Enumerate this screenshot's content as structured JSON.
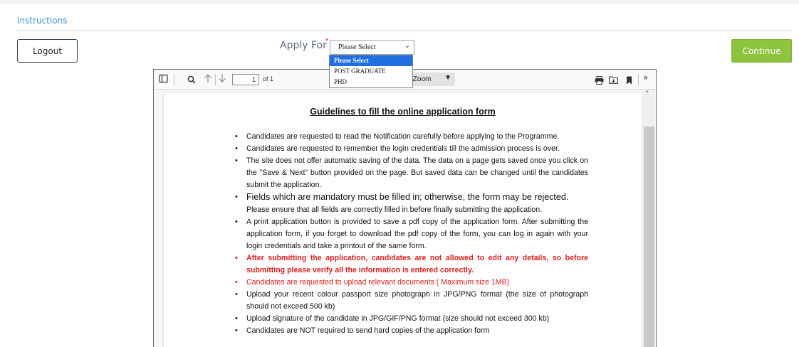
{
  "tab": {
    "title": "Instructions"
  },
  "buttons": {
    "logout": "Logout",
    "continue": "Continue"
  },
  "apply": {
    "label": "Apply For",
    "required_mark": "*",
    "selected": "Please Select",
    "options": [
      "Please Select",
      "POST GRADUATE",
      "PHD"
    ]
  },
  "viewer": {
    "page_number": "1",
    "page_count": "of 1",
    "zoom_label": "Automatic Zoom",
    "zoom_visible": "c Zoom"
  },
  "doc": {
    "title": "Guidelines  to fill the online application form",
    "items": [
      "Candidates are requested to read the Notification  carefully before applying to the Programme.",
      "Candidates are requested to remember the login credentials till the admission process is over.",
      "The site does not offer automatic saving of the data. The data on a page gets saved once you click on the \"Save & Next\" button provided on the page. But saved data can be changed until the candidates submit  the application.",
      "Fields which are mandatory must be filled in; otherwise, the form may be rejected.",
      "Please ensure that all fields are correctly filled in before finally submitting the application.",
      "A print application button is provided to save a pdf copy of the application form. After submitting the application form, if you forget to download the pdf copy of the form, you can log in again with your login credentials and take a printout of the same form.",
      "After submitting the application, candidates are not allowed to edit any details, so before submitting please verify all the information is entered correctly.",
      "Candidates are requested to upload relevant documents  ( Maximum size 1MB)",
      "Upload your recent colour passport size photograph in JPG/PNG format (the size of photograph should not exceed 500 kb)",
      "Upload signature of the candidate  in JPG/GIF/PNG format (size should not exceed 300 kb)",
      "Candidates are NOT required to send hard copies of the application form"
    ]
  },
  "colors": {
    "accent_blue": "#3a8fd0",
    "continue_green": "#8cc43e",
    "warning_red": "#d9211e",
    "dropdown_highlight": "#1f6fe3"
  }
}
